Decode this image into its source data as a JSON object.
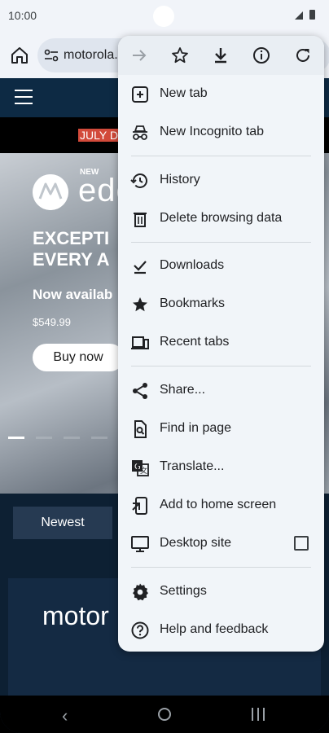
{
  "status": {
    "time": "10:00"
  },
  "toolbar": {
    "url": "motorola."
  },
  "page": {
    "promo": "JULY D",
    "hero": {
      "new_label": "NEW",
      "brand": "ede",
      "headline_1": "EXCEPTI",
      "headline_2": "EVERY A",
      "availability": "Now availab",
      "price": "$549.99",
      "buy_label": "Buy now"
    },
    "newest_label": "Newest",
    "card_title": "motor"
  },
  "menu": {
    "icons": [
      "forward-icon",
      "bookmark-star-icon",
      "download-icon",
      "info-icon",
      "refresh-icon"
    ],
    "items": [
      {
        "label": "New tab",
        "icon": "new-tab-icon"
      },
      {
        "label": "New Incognito tab",
        "icon": "incognito-icon"
      },
      {
        "label": "History",
        "icon": "history-icon"
      },
      {
        "label": "Delete browsing data",
        "icon": "trash-icon"
      },
      {
        "label": "Downloads",
        "icon": "downloads-check-icon"
      },
      {
        "label": "Bookmarks",
        "icon": "star-icon"
      },
      {
        "label": "Recent tabs",
        "icon": "recent-tabs-icon"
      },
      {
        "label": "Share...",
        "icon": "share-icon"
      },
      {
        "label": "Find in page",
        "icon": "find-in-page-icon"
      },
      {
        "label": "Translate...",
        "icon": "translate-icon"
      },
      {
        "label": "Add to home screen",
        "icon": "add-to-home-icon"
      },
      {
        "label": "Desktop site",
        "icon": "desktop-icon"
      },
      {
        "label": "Settings",
        "icon": "settings-icon"
      },
      {
        "label": "Help and feedback",
        "icon": "help-icon"
      }
    ],
    "desktop_site_checked": false
  }
}
